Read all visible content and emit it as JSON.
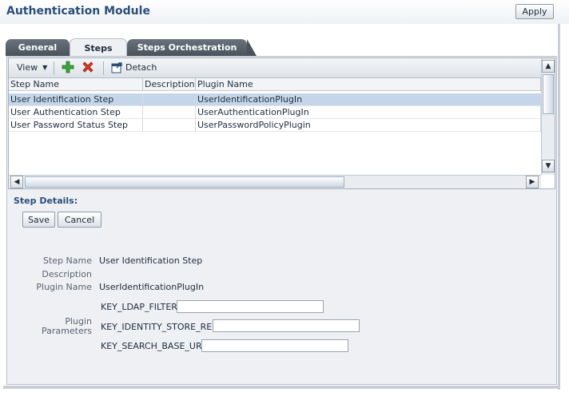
{
  "header": {
    "title": "Authentication Module",
    "apply_label": "Apply"
  },
  "tabs": [
    {
      "label": "General",
      "active": false
    },
    {
      "label": "Steps",
      "active": true
    },
    {
      "label": "Steps Orchestration",
      "active": false
    }
  ],
  "toolbar": {
    "view_label": "View",
    "add_icon": "plus-icon",
    "delete_icon": "x-icon",
    "detach_label": "Detach"
  },
  "table": {
    "columns": [
      "Step Name",
      "Description",
      "Plugin Name"
    ],
    "rows": [
      {
        "step_name": "User Identification Step",
        "description": "",
        "plugin_name": "UserIdentificationPlugIn",
        "selected": true
      },
      {
        "step_name": "User Authentication Step",
        "description": "",
        "plugin_name": "UserAuthenticationPlugIn",
        "selected": false
      },
      {
        "step_name": "User Password Status Step",
        "description": "",
        "plugin_name": "UserPasswordPolicyPlugin",
        "selected": false
      }
    ]
  },
  "details": {
    "title": "Step Details:",
    "save_label": "Save",
    "cancel_label": "Cancel",
    "step_name_label": "Step Name",
    "step_name_value": "User Identification Step",
    "description_label": "Description",
    "description_value": "",
    "plugin_name_label": "Plugin Name",
    "plugin_name_value": "UserIdentificationPlugIn",
    "plugin_params_label_1": "Plugin",
    "plugin_params_label_2": "Parameters",
    "params": [
      {
        "key": "KEY_LDAP_FILTER",
        "value": ""
      },
      {
        "key": "KEY_IDENTITY_STORE_REF",
        "value": ""
      },
      {
        "key": "KEY_SEARCH_BASE_URL",
        "value": ""
      }
    ]
  },
  "colors": {
    "title": "#2c4f78",
    "selected_row": "#c5d6ea",
    "tab_dark": "#4a525b"
  }
}
